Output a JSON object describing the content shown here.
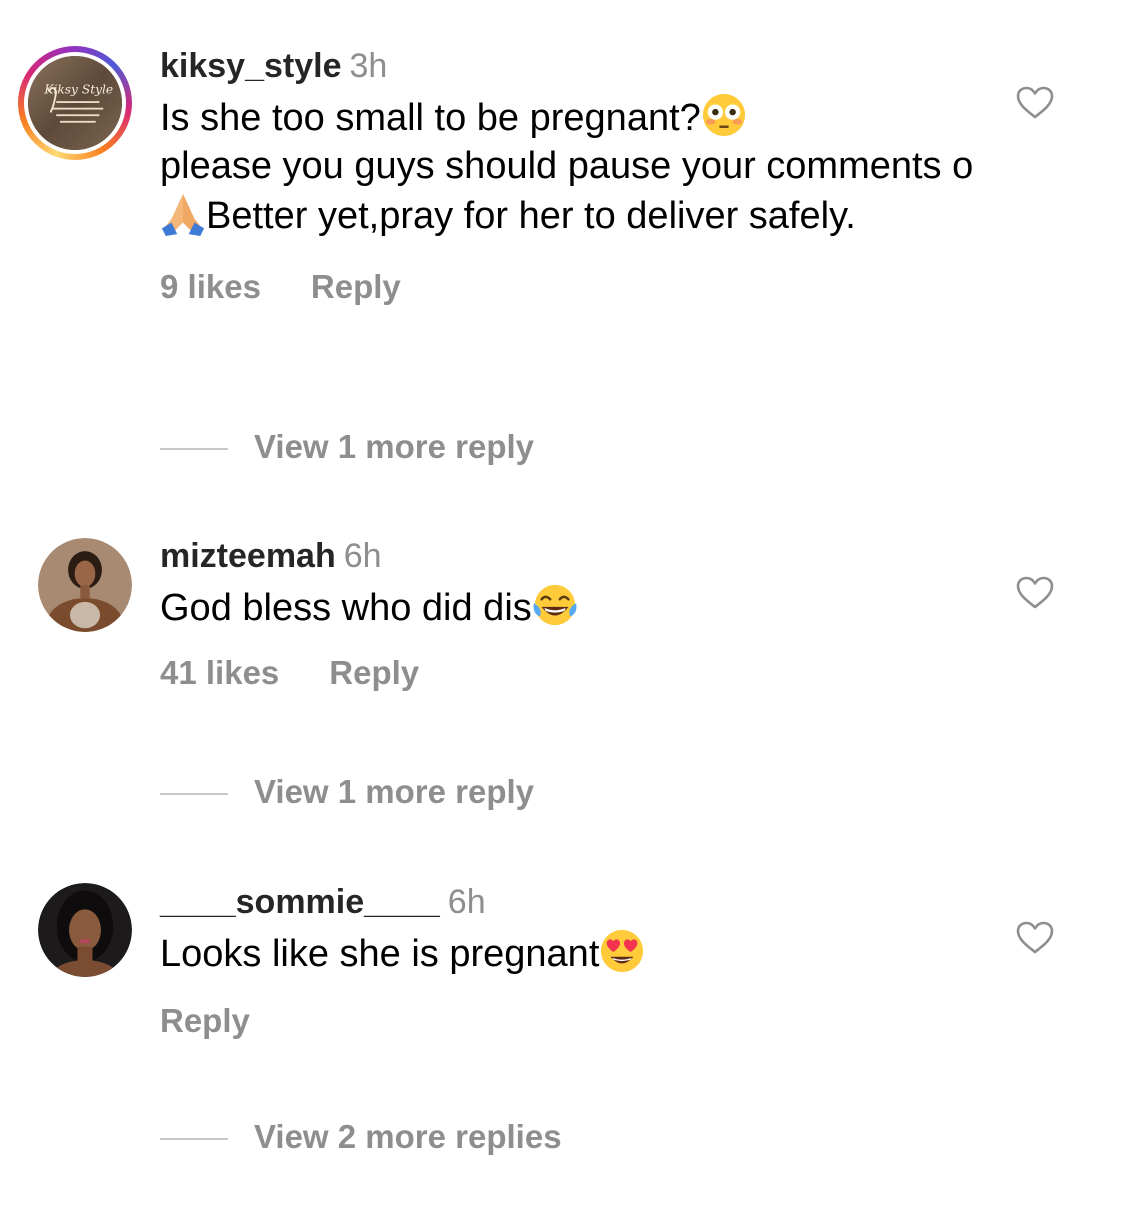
{
  "comments": [
    {
      "username": "kiksy_style",
      "time": "3h",
      "text_parts": [
        "Is she too small to be pregnant?",
        "please you guys should pause your comments o",
        "Better yet,pray for her to deliver safely."
      ],
      "emoji_1": "flushed-face",
      "emoji_2": "folded-hands",
      "likes": "9 likes",
      "reply_label": "Reply",
      "view_more": "View 1 more reply",
      "avatar_text": "Kiksy Style"
    },
    {
      "username": "mizteemah",
      "time": "6h",
      "text": "God bless who did dis",
      "emoji": "face-with-tears-of-joy",
      "likes": "41 likes",
      "reply_label": "Reply",
      "view_more": "View 1 more reply"
    },
    {
      "username": "____sommie____",
      "time": "6h",
      "text": "Looks like she is pregnant",
      "emoji": "smiling-face-with-heart-eyes",
      "reply_label": "Reply",
      "view_more": "View 2 more replies"
    }
  ],
  "colors": {
    "secondary_text": "#8e8e8e",
    "primary_text": "#000000",
    "divider": "#c7c7c7"
  },
  "icons": {
    "like": "heart-outline-icon"
  }
}
